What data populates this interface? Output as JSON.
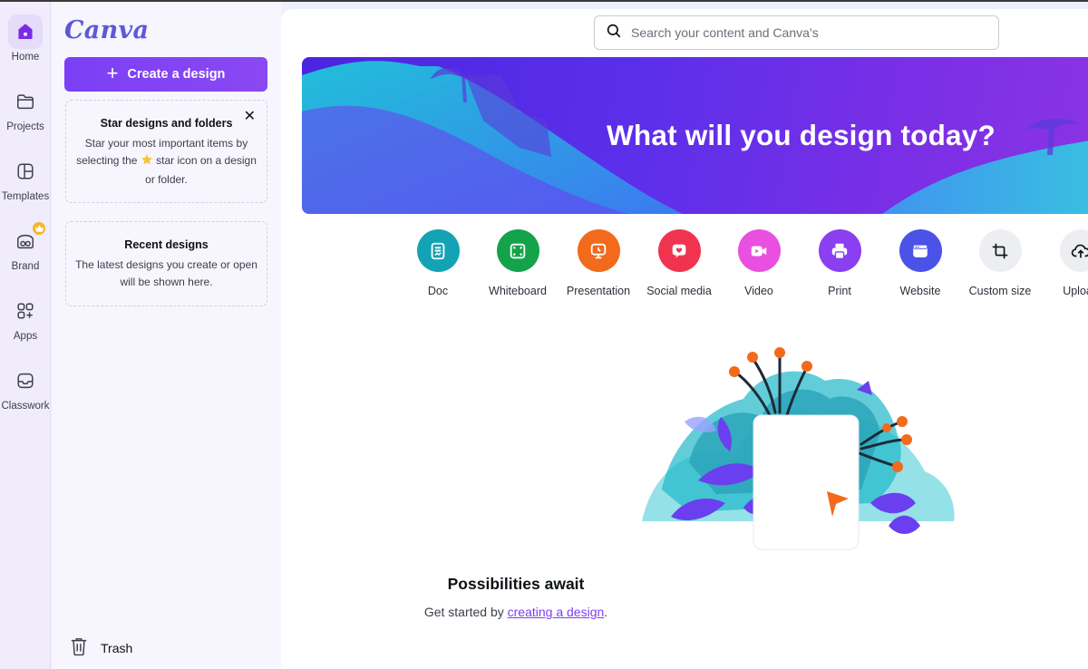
{
  "app": {
    "logo": "Canva"
  },
  "rail": {
    "items": [
      {
        "label": "Home",
        "icon": "home-icon",
        "active": true
      },
      {
        "label": "Projects",
        "icon": "folder-icon"
      },
      {
        "label": "Templates",
        "icon": "templates-icon"
      },
      {
        "label": "Brand",
        "icon": "brand-icon",
        "badge": "crown-icon"
      },
      {
        "label": "Apps",
        "icon": "apps-icon"
      },
      {
        "label": "Classwork",
        "icon": "inbox-icon"
      }
    ]
  },
  "panel": {
    "create_button": "Create a design",
    "star_card": {
      "title": "Star designs and folders",
      "text_before": "Star your most important items by selecting the",
      "text_after": "star icon on a design or folder."
    },
    "recent_card": {
      "title": "Recent designs",
      "text": "The latest designs you create or open will be shown here."
    },
    "trash_label": "Trash"
  },
  "search": {
    "placeholder": "Search your content and Canva’s"
  },
  "banner": {
    "title": "What will you design today?"
  },
  "design_types": [
    {
      "label": "Doc",
      "icon": "doc-icon",
      "color": "#13a3b5"
    },
    {
      "label": "Whiteboard",
      "icon": "whiteboard-icon",
      "color": "#14a34a"
    },
    {
      "label": "Presentation",
      "icon": "presentation-icon",
      "color": "#f26a1b"
    },
    {
      "label": "Social media",
      "icon": "heart-icon",
      "color": "#f0344f"
    },
    {
      "label": "Video",
      "icon": "video-icon",
      "color": "#e94fe0"
    },
    {
      "label": "Print",
      "icon": "printer-icon",
      "color": "#8a3ff0"
    },
    {
      "label": "Website",
      "icon": "website-icon",
      "color": "#4b52e8"
    },
    {
      "label": "Custom size",
      "icon": "crop-icon",
      "color": "#eceef2"
    },
    {
      "label": "Upload",
      "icon": "upload-cloud-icon",
      "color": "#eceef2"
    }
  ],
  "empty_state": {
    "title": "Possibilities await",
    "text_before": "Get started by",
    "link": "creating a design",
    "text_after": "."
  }
}
